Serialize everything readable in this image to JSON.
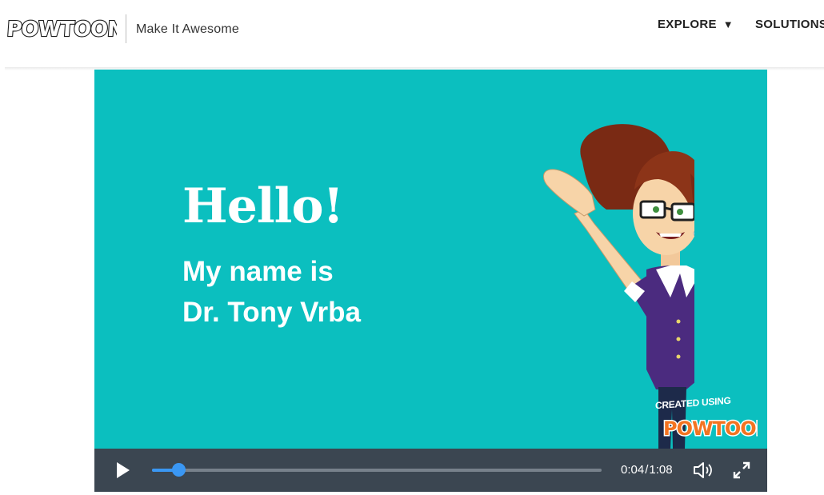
{
  "header": {
    "logo_text": "POWTOON",
    "tagline": "Make It Awesome",
    "nav": {
      "explore_label": "EXPLORE",
      "explore_caret": "▼",
      "solutions_label": "SOLUTIONS"
    }
  },
  "video": {
    "slide": {
      "headline": "Hello!",
      "line1": "My name is",
      "line2": "Dr. Tony Vrba"
    },
    "watermark": {
      "caption": "CREATED USING",
      "logo_text": "POWTOON"
    },
    "player": {
      "current_time": "0:04",
      "separator": "/",
      "duration": "1:08",
      "progress_fraction": 0.059
    }
  },
  "colors": {
    "slide_background": "#0bbfbf",
    "controls_background": "#3b4651",
    "progress_accent": "#3a97f3"
  },
  "icons": {
    "play": "play-icon",
    "volume": "volume-icon",
    "fullscreen": "fullscreen-icon"
  }
}
